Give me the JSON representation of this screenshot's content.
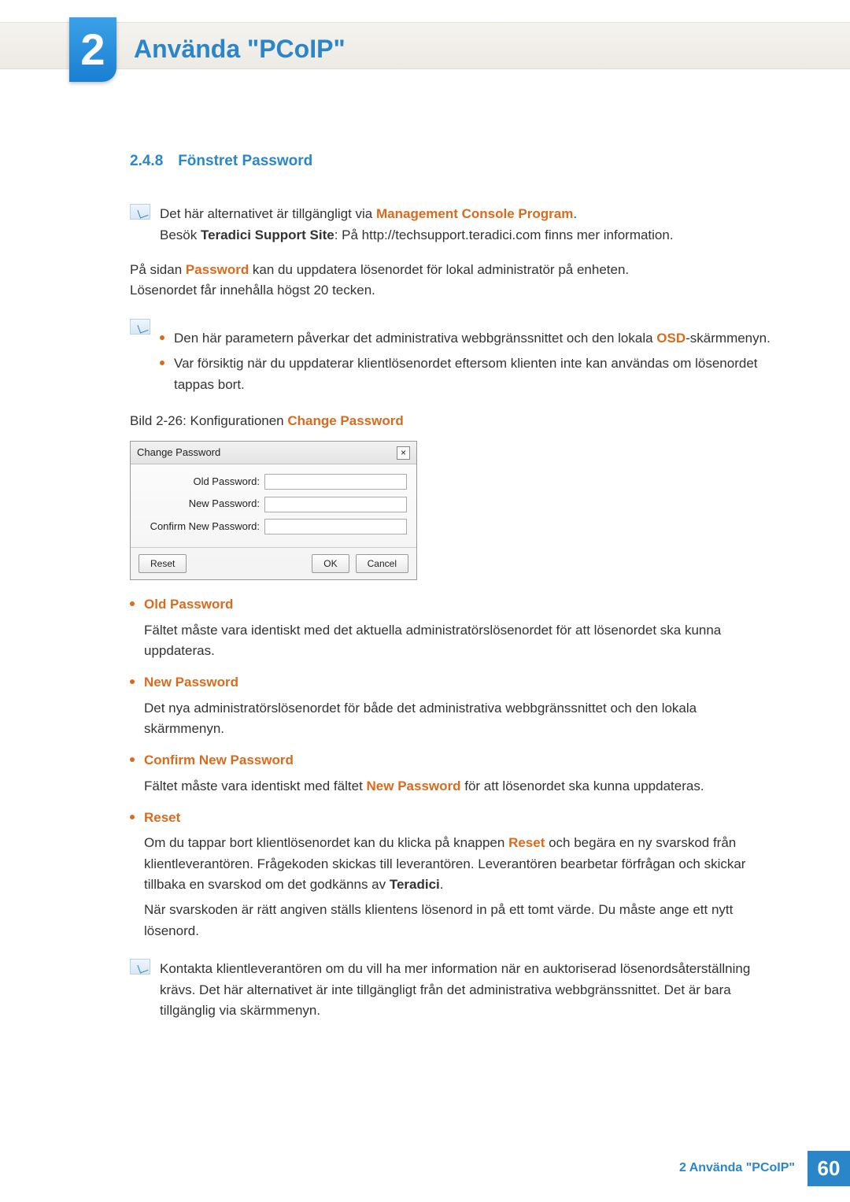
{
  "chapter": {
    "number": "2",
    "title": "Använda \"PCoIP\""
  },
  "section": {
    "number": "2.4.8",
    "title": "Fönstret Password"
  },
  "note1": {
    "line1_pre": "Det här alternativet är tillgängligt via ",
    "line1_em": "Management Console Program",
    "line1_post": ".",
    "line2_pre": "Besök ",
    "line2_bold": "Teradici Support Site",
    "line2_post": ": På http://techsupport.teradici.com finns mer information."
  },
  "intro": {
    "p1_pre": "På sidan ",
    "p1_em": "Password",
    "p1_post": " kan du uppdatera lösenordet för lokal administratör på enheten.",
    "p2": "Lösenordet får innehålla högst 20 tecken."
  },
  "note2": {
    "b1_pre": "Den här parametern påverkar det administrativa webbgränssnittet och den lokala ",
    "b1_em": "OSD",
    "b1_post": "-skärmmenyn.",
    "b2": "Var försiktig när du uppdaterar klientlösenordet eftersom klienten inte kan användas om lösenordet tappas bort."
  },
  "figure": {
    "caption_pre": "Bild 2-26: Konfigurationen ",
    "caption_em": "Change Password"
  },
  "dialog": {
    "title": "Change Password",
    "close": "×",
    "old": "Old Password:",
    "new": "New Password:",
    "confirm": "Confirm New Password:",
    "reset": "Reset",
    "ok": "OK",
    "cancel": "Cancel"
  },
  "fields": {
    "old": {
      "name": "Old Password",
      "desc": "Fältet måste vara identiskt med det aktuella administratörslösenordet för att lösenordet ska kunna uppdateras."
    },
    "new": {
      "name": "New Password",
      "desc": "Det nya administratörslösenordet för både det administrativa webbgränssnittet och den lokala skärmmenyn."
    },
    "confirm": {
      "name": "Confirm New Password",
      "desc_pre": "Fältet måste vara identiskt med fältet ",
      "desc_em": "New Password",
      "desc_post": " för att lösenordet ska kunna uppdateras."
    },
    "reset": {
      "name": "Reset",
      "desc1_pre": "Om du tappar bort klientlösenordet kan du klicka på knappen ",
      "desc1_em": "Reset",
      "desc1_mid": " och begära en ny svarskod från klientleverantören. Frågekoden skickas till leverantören. Leverantören bearbetar förfrågan och skickar tillbaka en svarskod om det godkänns av ",
      "desc1_bold": "Teradici",
      "desc1_post": ".",
      "desc2": "När svarskoden är rätt angiven ställs klientens lösenord in på ett tomt värde. Du måste ange ett nytt lösenord."
    }
  },
  "note3": {
    "text": "Kontakta klientleverantören om du vill ha mer information när en auktoriserad lösenordsåterställning krävs. Det här alternativet är inte tillgängligt från det administrativa webbgränssnittet. Det är bara tillgänglig via skärmmenyn."
  },
  "footer": {
    "label": "2 Använda \"PCoIP\"",
    "page": "60"
  }
}
